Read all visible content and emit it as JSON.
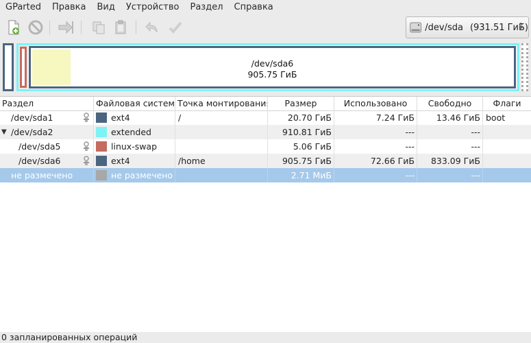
{
  "menu": [
    "GParted",
    "Правка",
    "Вид",
    "Устройство",
    "Раздел",
    "Справка"
  ],
  "device": {
    "name": "/dev/sda",
    "size": "(931.51 ГиБ)",
    "icon": "hard-disk-icon"
  },
  "disk_graphic": {
    "selected_partition": "/dev/sda6",
    "selected_size": "905.75 ГиБ"
  },
  "table": {
    "headers": [
      "Раздел",
      "Файловая система",
      "Точка монтирования",
      "Размер",
      "Использовано",
      "Свободно",
      "Флаги"
    ],
    "rows": [
      {
        "partition": "/dev/sda1",
        "fs": "ext4",
        "fs_color": "#4a6580",
        "mount": "/",
        "size": "20.70 ГиБ",
        "used": "7.24 ГиБ",
        "free": "13.46 ГиБ",
        "flags": "boot",
        "locked": true
      },
      {
        "partition": "/dev/sda2",
        "fs": "extended",
        "fs_color": "#7ef2f5",
        "mount": "",
        "size": "910.81 ГиБ",
        "used": "---",
        "free": "---",
        "flags": "",
        "locked": false
      },
      {
        "partition": "/dev/sda5",
        "fs": "linux-swap",
        "fs_color": "#c56b5f",
        "mount": "",
        "size": "5.06 ГиБ",
        "used": "---",
        "free": "---",
        "flags": "",
        "locked": true
      },
      {
        "partition": "/dev/sda6",
        "fs": "ext4",
        "fs_color": "#4a6580",
        "mount": "/home",
        "size": "905.75 ГиБ",
        "used": "72.66 ГиБ",
        "free": "833.09 ГиБ",
        "flags": "",
        "locked": true
      },
      {
        "partition": "не размечено",
        "fs": "не размечено",
        "fs_color": "#a8a8a8",
        "mount": "",
        "size": "2.71 МиБ",
        "used": "---",
        "free": "---",
        "flags": "",
        "locked": false
      }
    ]
  },
  "status": "0 запланированных операций",
  "colors": {
    "ext4": "#4a6580",
    "extended": "#7ef2f5",
    "swap": "#c56b5f",
    "used_fill": "#f7f7c0",
    "selection": "#a5c9ea"
  }
}
